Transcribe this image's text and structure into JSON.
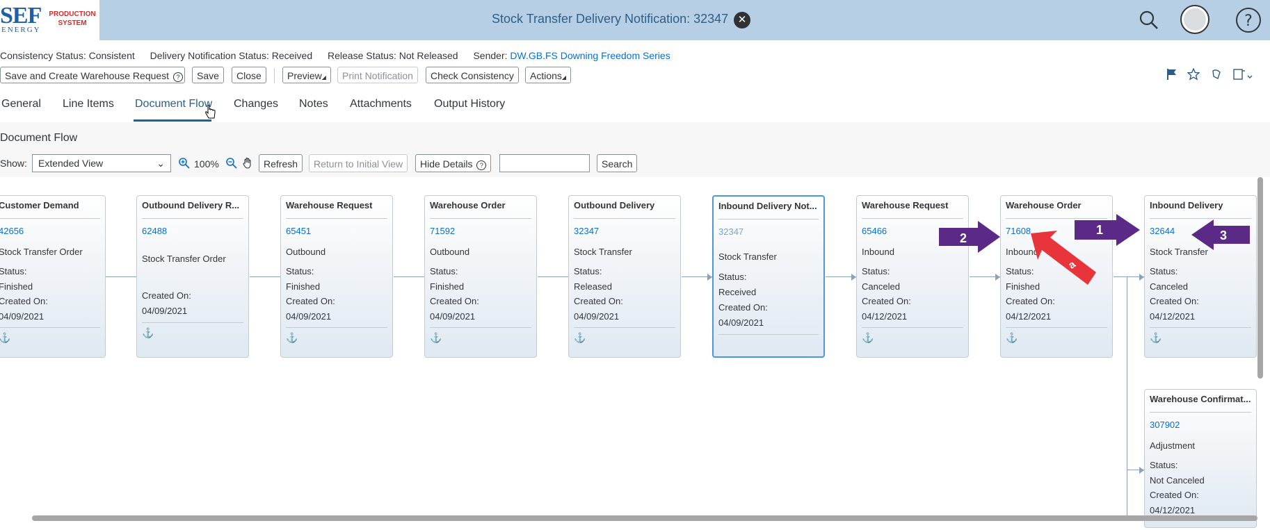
{
  "logo": {
    "mark": "SEF",
    "sub": "ENERGY",
    "product_line1": "PRODUCTION",
    "product_line2": "SYSTEM"
  },
  "shell": {
    "title": "Stock Transfer Delivery Notification: 32347",
    "icons": [
      "close-icon",
      "search-icon",
      "user-avatar",
      "help-icon"
    ]
  },
  "header": {
    "consistency_label": "Consistency Status:",
    "consistency_value": "Consistent",
    "delivery_label": "Delivery Notification Status:",
    "delivery_value": "Received",
    "release_label": "Release Status:",
    "release_value": "Not Released",
    "sender_label": "Sender:",
    "sender_value": "DW.GB.FS Downing Freedom Series"
  },
  "toolbar": {
    "save_create": "Save and Create Warehouse Request",
    "save": "Save",
    "close": "Close",
    "preview": "Preview",
    "print": "Print Notification",
    "check": "Check Consistency",
    "actions": "Actions"
  },
  "tabs": [
    "General",
    "Line Items",
    "Document Flow",
    "Changes",
    "Notes",
    "Attachments",
    "Output History"
  ],
  "active_tab": "Document Flow",
  "flow": {
    "section_title": "Document Flow",
    "show_label": "Show:",
    "show_value": "Extended View",
    "zoom": "100%",
    "refresh": "Refresh",
    "return_initial": "Return to Initial View",
    "hide_details": "Hide Details",
    "search": "Search"
  },
  "cards": [
    {
      "title": "Customer Demand",
      "id": "42656",
      "sub": "Stock Transfer Order",
      "status_label": "Status:",
      "status": "Finished",
      "created_label": "Created On:",
      "created": "04/09/2021"
    },
    {
      "title": "Outbound Delivery R...",
      "id": "62488",
      "sub": "Stock Transfer Order",
      "status_label": "",
      "status": "",
      "created_label": "Created On:",
      "created": "04/09/2021"
    },
    {
      "title": "Warehouse Request",
      "id": "65451",
      "sub": "Outbound",
      "status_label": "Status:",
      "status": "Finished",
      "created_label": "Created On:",
      "created": "04/09/2021"
    },
    {
      "title": "Warehouse Order",
      "id": "71592",
      "sub": "Outbound",
      "status_label": "Status:",
      "status": "Finished",
      "created_label": "Created On:",
      "created": "04/09/2021"
    },
    {
      "title": "Outbound Delivery",
      "id": "32347",
      "sub": "Stock Transfer",
      "status_label": "Status:",
      "status": "Released",
      "created_label": "Created On:",
      "created": "04/09/2021"
    },
    {
      "title": "Inbound Delivery Not...",
      "id": "32347",
      "sub": "Stock Transfer",
      "status_label": "Status:",
      "status": "Received",
      "created_label": "Created On:",
      "created": "04/09/2021"
    },
    {
      "title": "Warehouse Request",
      "id": "65466",
      "sub": "Inbound",
      "status_label": "Status:",
      "status": "Canceled",
      "created_label": "Created On:",
      "created": "04/12/2021"
    },
    {
      "title": "Warehouse Order",
      "id": "71608",
      "sub": "Inbound",
      "status_label": "Status:",
      "status": "Finished",
      "created_label": "Created On:",
      "created": "04/12/2021"
    },
    {
      "title": "Inbound Delivery",
      "id": "32644",
      "sub": "Stock Transfer",
      "status_label": "Status:",
      "status": "Canceled",
      "created_label": "Created On:",
      "created": "04/12/2021"
    },
    {
      "title": "Warehouse Confirmat...",
      "id": "307902",
      "sub": "Adjustment",
      "status_label": "Status:",
      "status": "Not Canceled",
      "created_label": "Created On:",
      "created": "04/12/2021"
    }
  ],
  "annotations": {
    "a1": "1",
    "a2": "2",
    "a3": "3",
    "aa": "a",
    "colors": {
      "purple": "#5b2a86",
      "red": "#e8353b"
    }
  }
}
